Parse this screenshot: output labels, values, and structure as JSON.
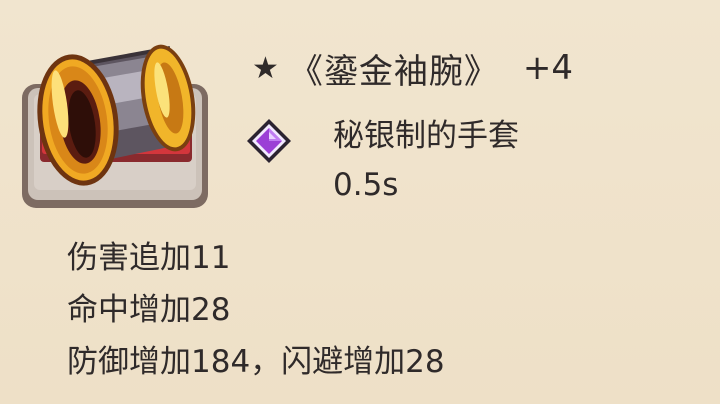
{
  "item": {
    "star": "★",
    "name": "《鎏金袖腕》",
    "level": "+4",
    "icon": "golden-bracer-icon",
    "rarity_icon": "purple-gem-icon",
    "material": "秘银制的手套",
    "cooldown": "0.5s"
  },
  "stats": [
    "伤害追加11",
    "命中增加28",
    "防御增加184，闪避增加28"
  ],
  "colors": {
    "background": "#efe2cb",
    "text": "#2f2a2a",
    "gold": "#e8a21c",
    "gem": "#9b3fd6",
    "frame_red": "#c8323a"
  }
}
